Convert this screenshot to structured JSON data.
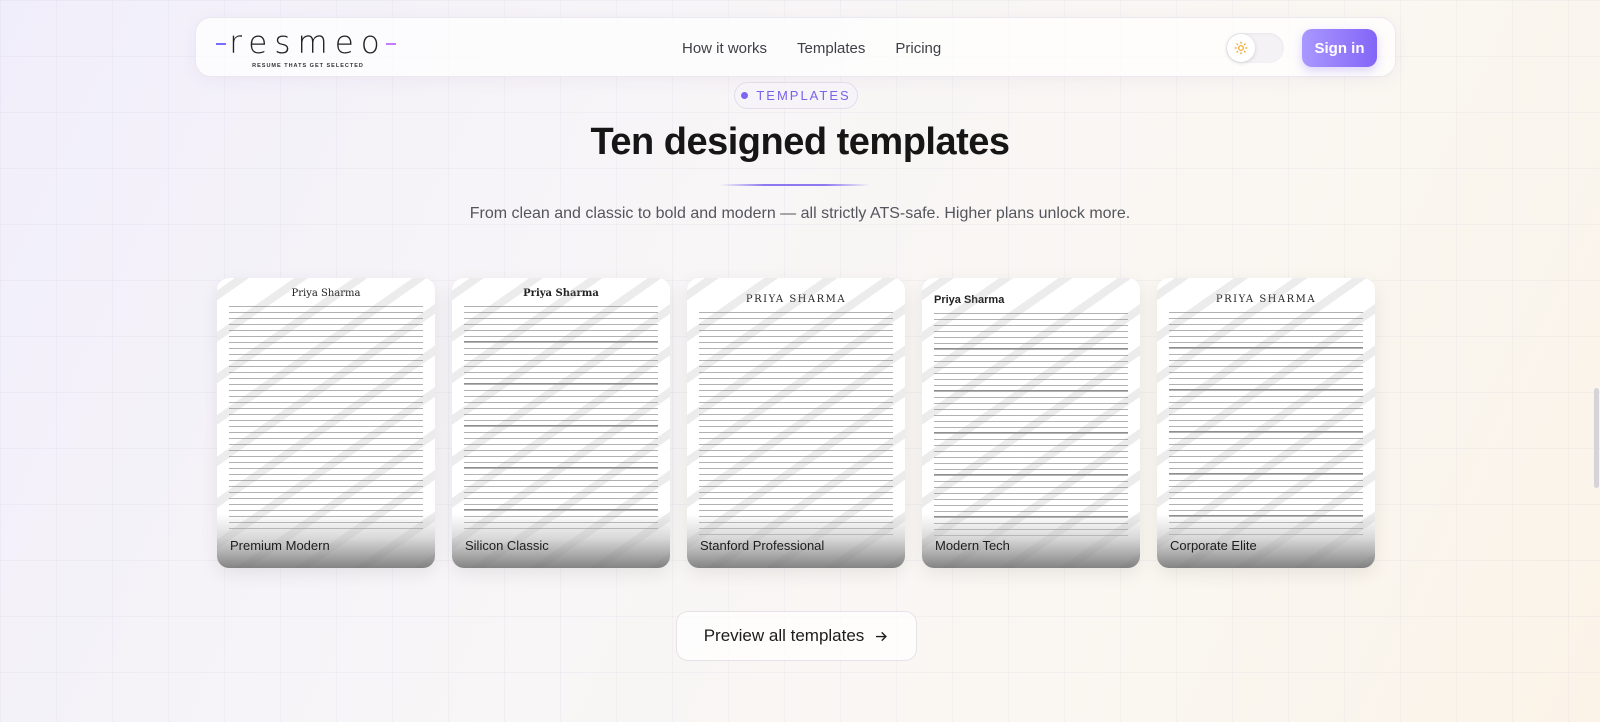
{
  "nav": {
    "logo_text": "resmeo",
    "logo_tagline": "RESUME THATS GET SELECTED",
    "links": [
      "How it works",
      "Templates",
      "Pricing"
    ],
    "signin_label": "Sign in",
    "theme_icon": "sun-icon"
  },
  "section": {
    "badge": "TEMPLATES",
    "title": "Ten designed templates",
    "subtitle": "From clean and classic to bold and modern — all strictly ATS-safe. Higher plans unlock more."
  },
  "templates": [
    {
      "label": "Premium Modern",
      "preview_name": "Priya Sharma"
    },
    {
      "label": "Silicon Classic",
      "preview_name": "Priya Sharma"
    },
    {
      "label": "Stanford Professional",
      "preview_name": "PRIYA SHARMA"
    },
    {
      "label": "Modern Tech",
      "preview_name": "Priya Sharma"
    },
    {
      "label": "Corporate Elite",
      "preview_name": "PRIYA SHARMA"
    }
  ],
  "cta": {
    "label": "Preview all templates",
    "icon": "arrow-right-icon"
  },
  "colors": {
    "accent": "#8365f7",
    "accent_light": "#a998ff"
  }
}
